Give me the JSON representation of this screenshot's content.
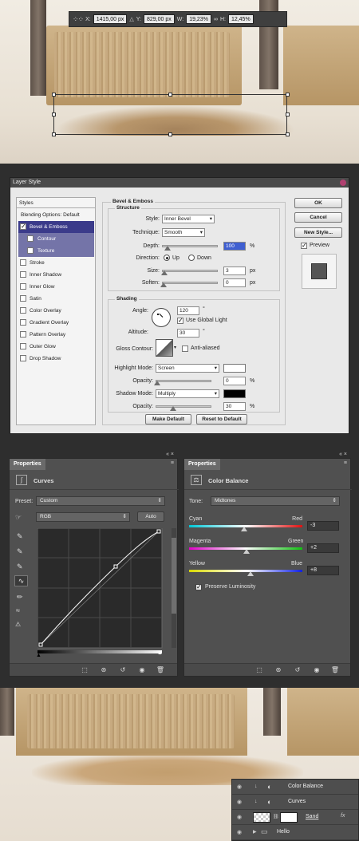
{
  "transform_bar": {
    "x_label": "X:",
    "x_value": "1415,00 px",
    "y_label": "Y:",
    "y_value": "829,00 px",
    "w_label": "W:",
    "w_value": "19,23%",
    "h_label": "H:",
    "h_value": "12,45%"
  },
  "layer_style": {
    "title": "Layer Style",
    "styles_header": "Styles",
    "styles": [
      {
        "label": "Blending Options: Default",
        "checkbox": false,
        "selected": false,
        "sub": false
      },
      {
        "label": "Bevel & Emboss",
        "checkbox": true,
        "checked": true,
        "selected": true,
        "sub": false
      },
      {
        "label": "Contour",
        "checkbox": true,
        "checked": false,
        "selected": false,
        "sub": true
      },
      {
        "label": "Texture",
        "checkbox": true,
        "checked": false,
        "selected": false,
        "sub": true
      },
      {
        "label": "Stroke",
        "checkbox": true,
        "checked": false
      },
      {
        "label": "Inner Shadow",
        "checkbox": true,
        "checked": false
      },
      {
        "label": "Inner Glow",
        "checkbox": true,
        "checked": false
      },
      {
        "label": "Satin",
        "checkbox": true,
        "checked": false
      },
      {
        "label": "Color Overlay",
        "checkbox": true,
        "checked": false
      },
      {
        "label": "Gradient Overlay",
        "checkbox": true,
        "checked": false
      },
      {
        "label": "Pattern Overlay",
        "checkbox": true,
        "checked": false
      },
      {
        "label": "Outer Glow",
        "checkbox": true,
        "checked": false
      },
      {
        "label": "Drop Shadow",
        "checkbox": true,
        "checked": false
      }
    ],
    "section_title": "Bevel & Emboss",
    "structure": {
      "title": "Structure",
      "style_label": "Style:",
      "style_value": "Inner Bevel",
      "technique_label": "Technique:",
      "technique_value": "Smooth",
      "depth_label": "Depth:",
      "depth_value": "100",
      "depth_unit": "%",
      "depth_level": 0.08,
      "direction_label": "Direction:",
      "direction_up": "Up",
      "direction_down": "Down",
      "size_label": "Size:",
      "size_value": "3",
      "size_unit": "px",
      "size_level": 0.02,
      "soften_label": "Soften:",
      "soften_value": "0",
      "soften_unit": "px",
      "soften_level": 0.0
    },
    "shading": {
      "title": "Shading",
      "angle_label": "Angle:",
      "angle_value": "120",
      "angle_unit": "°",
      "global_light_label": "Use Global Light",
      "altitude_label": "Altitude:",
      "altitude_value": "30",
      "altitude_unit": "°",
      "gloss_label": "Gloss Contour:",
      "anti_aliased_label": "Anti-aliased",
      "highlight_label": "Highlight Mode:",
      "highlight_value": "Screen",
      "highlight_opacity_label": "Opacity:",
      "highlight_opacity_value": "0",
      "highlight_opacity_unit": "%",
      "shadow_label": "Shadow Mode:",
      "shadow_value": "Multiply",
      "shadow_opacity_label": "Opacity:",
      "shadow_opacity_value": "30",
      "shadow_opacity_unit": "%",
      "highlight_color": "#ffffff",
      "shadow_color": "#000000"
    },
    "make_default": "Make Default",
    "reset_default": "Reset to Default",
    "ok": "OK",
    "cancel": "Cancel",
    "new_style": "New Style...",
    "preview": "Preview"
  },
  "curves_panel": {
    "tab": "Properties",
    "title": "Curves",
    "preset_label": "Preset:",
    "preset_value": "Custom",
    "channel_value": "RGB",
    "auto_label": "Auto"
  },
  "color_balance_panel": {
    "tab": "Properties",
    "title": "Color Balance",
    "tone_label": "Tone:",
    "tone_value": "Midtones",
    "sliders": [
      {
        "left": "Cyan",
        "right": "Red",
        "value": "-3",
        "level": -3
      },
      {
        "left": "Magenta",
        "right": "Green",
        "value": "+2",
        "level": 2
      },
      {
        "left": "Yellow",
        "right": "Blue",
        "value": "+8",
        "level": 8
      }
    ],
    "preserve_label": "Preserve Luminosity"
  },
  "layers": [
    {
      "name": "Color Balance",
      "type": "adjustment"
    },
    {
      "name": "Curves",
      "type": "adjustment"
    },
    {
      "name": "Sand",
      "type": "layer"
    },
    {
      "name": "Hello",
      "type": "group"
    }
  ],
  "colors": {
    "selected_style": "#3b3b8a",
    "sub_style": "#7474a8",
    "accent": "#c9a77c"
  }
}
